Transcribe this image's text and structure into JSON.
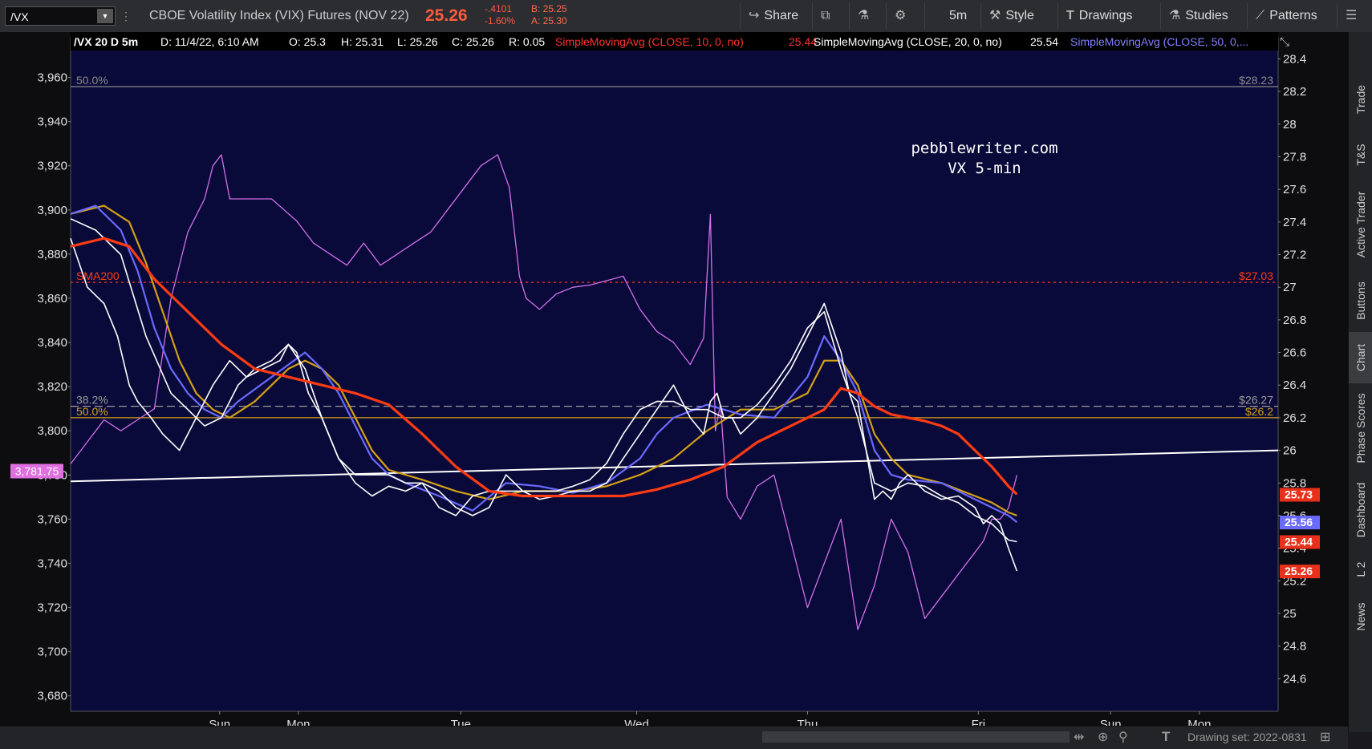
{
  "toolbar": {
    "symbol": "/VX",
    "description": "CBOE Volatility Index (VIX) Futures (NOV 22)",
    "last_price": "25.26",
    "net_change": "-.4101",
    "pct_change": "-1.60%",
    "bid": "B: 25.25",
    "ask": "A: 25.30",
    "share_label": "Share",
    "timeframe": "5m",
    "style_label": "Style",
    "drawings_label": "Drawings",
    "studies_label": "Studies",
    "patterns_label": "Patterns"
  },
  "header": {
    "title": "/VX 20 D 5m",
    "date": "D: 11/4/22, 6:10 AM",
    "open": "O: 25.3",
    "high": "H: 25.31",
    "low": "L: 25.26",
    "close": "C: 25.26",
    "range": "R: 0.05",
    "sma1_label": "SimpleMovingAvg (CLOSE, 10, 0, no)",
    "sma1_value": "25.44",
    "sma2_label": "SimpleMovingAvg (CLOSE, 20, 0, no)",
    "sma2_value": "25.54",
    "sma3_label": "SimpleMovingAvg (CLOSE, 50, 0,..."
  },
  "watermark": {
    "line1": "pebblewriter.com",
    "line2": "VX 5-min"
  },
  "side_tabs": [
    "Trade",
    "T&S",
    "Active Trader",
    "Buttons",
    "Chart",
    "Phase Scores",
    "Dashboard",
    "L 2",
    "News"
  ],
  "status_bar": {
    "drawing_set": "Drawing set: 2022-0831"
  },
  "colors": {
    "background": "#0a0a3a",
    "spx": "#d070e8",
    "price": "#ffffff",
    "sma200": "#ff3b14",
    "sma10": "#ff3030",
    "sma20": "#ffffff",
    "sma50": "#7070ff",
    "sma_gold": "#d4a017",
    "fib_gold": "#d4a017"
  },
  "chart_data": {
    "type": "line",
    "left_axis": {
      "ylim": [
        3673,
        3978
      ],
      "ticks": [
        3680,
        3700,
        3720,
        3740,
        3760,
        3780,
        3800,
        3820,
        3840,
        3860,
        3880,
        3900,
        3920,
        3940,
        3960
      ],
      "marker": "3,781.75"
    },
    "right_axis": {
      "ylim": [
        24.4,
        28.53
      ],
      "ticks": [
        24.6,
        24.8,
        25,
        25.2,
        25.4,
        25.6,
        25.8,
        26,
        26.2,
        26.4,
        26.6,
        26.8,
        27,
        27.2,
        27.4,
        27.6,
        27.8,
        28,
        28.2,
        28.4
      ]
    },
    "x_axis": {
      "xlim": [
        0,
        7.21
      ],
      "tick_labels": [
        "Sun",
        "Mon",
        "Tue",
        "Wed",
        "Thu",
        "Fri",
        "Sun",
        "Mon"
      ],
      "tick_positions": [
        0.89,
        1.36,
        2.33,
        3.38,
        4.4,
        5.42,
        6.21,
        6.74
      ]
    },
    "levels": [
      {
        "label": "50.0%",
        "value_label": "$28.23",
        "value": 28.23,
        "style": "solid-gray"
      },
      {
        "label": "SMA200",
        "value_label": "$27.03",
        "value": 27.03,
        "style": "dashed-red"
      },
      {
        "label": "38.2%",
        "value_label": "$26.27",
        "value": 26.27,
        "style": "dashed-gray"
      },
      {
        "label": "50.0%",
        "value_label": "$26.2",
        "value": 26.2,
        "style": "solid-gold"
      }
    ],
    "trendline": {
      "x": [
        0,
        7.21
      ],
      "y": [
        25.81,
        26.0
      ]
    },
    "price_labels": [
      {
        "text": "25.73",
        "value": 25.73,
        "color": "#e8301a"
      },
      {
        "text": "25.56",
        "value": 25.56,
        "color": "#6a6aff"
      },
      {
        "text": "25.44",
        "value": 25.44,
        "color": "#e8301a"
      },
      {
        "text": "25.26",
        "value": 25.26,
        "color": "#e8301a"
      }
    ],
    "series": [
      {
        "name": "VX",
        "color": "#ffffff",
        "axis": "right",
        "x": [
          0,
          0.1,
          0.2,
          0.28,
          0.35,
          0.4,
          0.48,
          0.55,
          0.65,
          0.75,
          0.85,
          0.95,
          1.05,
          1.15,
          1.25,
          1.3,
          1.35,
          1.42,
          1.5,
          1.6,
          1.7,
          1.8,
          1.9,
          2.0,
          2.1,
          2.2,
          2.3,
          2.4,
          2.5,
          2.6,
          2.7,
          2.8,
          2.9,
          3.0,
          3.1,
          3.2,
          3.3,
          3.4,
          3.5,
          3.6,
          3.7,
          3.78,
          3.82,
          3.86,
          3.9,
          3.95,
          4.0,
          4.1,
          4.2,
          4.3,
          4.4,
          4.5,
          4.6,
          4.65,
          4.7,
          4.75,
          4.8,
          4.85,
          4.9,
          4.95,
          5.0,
          5.1,
          5.2,
          5.3,
          5.4,
          5.45,
          5.5,
          5.55,
          5.6,
          5.65
        ],
        "values": [
          27.3,
          27.0,
          26.9,
          26.7,
          26.4,
          26.3,
          26.2,
          26.1,
          26.0,
          26.2,
          26.4,
          26.55,
          26.45,
          26.5,
          26.55,
          26.65,
          26.6,
          26.35,
          26.2,
          25.95,
          25.8,
          25.72,
          25.78,
          25.75,
          25.8,
          25.75,
          25.65,
          25.6,
          25.65,
          25.85,
          25.75,
          25.7,
          25.72,
          25.75,
          25.75,
          25.8,
          25.95,
          26.1,
          26.25,
          26.4,
          26.2,
          26.1,
          26.3,
          26.35,
          26.2,
          26.2,
          26.1,
          26.2,
          26.35,
          26.5,
          26.7,
          26.9,
          26.6,
          26.35,
          26.3,
          26.0,
          25.7,
          25.75,
          25.7,
          25.8,
          25.85,
          25.75,
          25.7,
          25.72,
          25.65,
          25.55,
          25.6,
          25.55,
          25.4,
          25.26
        ]
      },
      {
        "name": "SMA 20",
        "color": "#ffffff",
        "axis": "right",
        "x": [
          0,
          0.15,
          0.3,
          0.45,
          0.6,
          0.7,
          0.8,
          0.9,
          1.0,
          1.1,
          1.2,
          1.3,
          1.4,
          1.5,
          1.6,
          1.7,
          1.8,
          1.9,
          2.0,
          2.1,
          2.2,
          2.3,
          2.4,
          2.5,
          2.6,
          2.7,
          2.8,
          2.9,
          3.0,
          3.1,
          3.2,
          3.3,
          3.4,
          3.5,
          3.6,
          3.7,
          3.8,
          3.9,
          4.0,
          4.1,
          4.2,
          4.3,
          4.4,
          4.5,
          4.6,
          4.7,
          4.8,
          4.9,
          5.0,
          5.1,
          5.2,
          5.3,
          5.4,
          5.5,
          5.6,
          5.65
        ],
        "values": [
          27.42,
          27.35,
          27.2,
          26.7,
          26.35,
          26.25,
          26.15,
          26.2,
          26.4,
          26.5,
          26.55,
          26.65,
          26.5,
          26.2,
          25.95,
          25.85,
          25.85,
          25.85,
          25.8,
          25.8,
          25.65,
          25.6,
          25.72,
          25.75,
          25.75,
          25.75,
          25.75,
          25.75,
          25.78,
          25.82,
          25.92,
          26.1,
          26.25,
          26.3,
          26.3,
          26.25,
          26.25,
          26.2,
          26.2,
          26.28,
          26.4,
          26.55,
          26.75,
          26.85,
          26.5,
          26.2,
          25.8,
          25.75,
          25.8,
          25.78,
          25.72,
          25.68,
          25.6,
          25.55,
          25.45,
          25.44
        ]
      },
      {
        "name": "SMA 50",
        "color": "#6a6aff",
        "axis": "right",
        "x": [
          0,
          0.15,
          0.3,
          0.4,
          0.5,
          0.6,
          0.7,
          0.8,
          0.9,
          1.0,
          1.2,
          1.4,
          1.5,
          1.6,
          1.7,
          1.8,
          1.9,
          2.0,
          2.2,
          2.4,
          2.6,
          2.8,
          3.0,
          3.2,
          3.4,
          3.5,
          3.6,
          3.8,
          4.0,
          4.2,
          4.4,
          4.5,
          4.6,
          4.7,
          4.8,
          4.9,
          5.0,
          5.2,
          5.4,
          5.6,
          5.65
        ],
        "values": [
          27.45,
          27.5,
          27.35,
          27.1,
          26.75,
          26.5,
          26.35,
          26.25,
          26.2,
          26.3,
          26.45,
          26.6,
          26.5,
          26.35,
          26.15,
          25.95,
          25.85,
          25.8,
          25.72,
          25.63,
          25.8,
          25.78,
          25.74,
          25.8,
          25.95,
          26.1,
          26.2,
          26.28,
          26.22,
          26.2,
          26.45,
          26.7,
          26.55,
          26.35,
          26.0,
          25.85,
          25.82,
          25.8,
          25.7,
          25.6,
          25.56
        ]
      },
      {
        "name": "SMA gold",
        "color": "#d4a017",
        "axis": "right",
        "x": [
          0,
          0.2,
          0.35,
          0.45,
          0.55,
          0.65,
          0.75,
          0.85,
          0.95,
          1.1,
          1.3,
          1.4,
          1.5,
          1.6,
          1.7,
          1.8,
          1.9,
          2.1,
          2.3,
          2.5,
          2.7,
          3.0,
          3.2,
          3.4,
          3.6,
          3.8,
          4.0,
          4.2,
          4.4,
          4.5,
          4.6,
          4.7,
          4.8,
          4.9,
          5.0,
          5.2,
          5.4,
          5.5,
          5.6,
          5.65
        ],
        "values": [
          27.45,
          27.5,
          27.4,
          27.15,
          26.85,
          26.55,
          26.35,
          26.25,
          26.2,
          26.3,
          26.5,
          26.55,
          26.5,
          26.4,
          26.2,
          26.0,
          25.88,
          25.82,
          25.75,
          25.7,
          25.75,
          25.75,
          25.78,
          25.85,
          25.95,
          26.12,
          26.25,
          26.25,
          26.35,
          26.55,
          26.55,
          26.4,
          26.1,
          25.95,
          25.85,
          25.8,
          25.72,
          25.68,
          25.62,
          25.6
        ]
      },
      {
        "name": "SMA200",
        "color": "#ff3b14",
        "axis": "right",
        "x": [
          0,
          0.2,
          0.35,
          0.5,
          0.7,
          0.9,
          1.1,
          1.3,
          1.5,
          1.7,
          1.9,
          2.1,
          2.3,
          2.5,
          2.7,
          2.9,
          3.1,
          3.3,
          3.5,
          3.7,
          3.9,
          4.1,
          4.3,
          4.5,
          4.6,
          4.7,
          4.8,
          4.9,
          5.0,
          5.1,
          5.2,
          5.3,
          5.4,
          5.5,
          5.6,
          5.65
        ],
        "values": [
          27.25,
          27.3,
          27.25,
          27.05,
          26.85,
          26.65,
          26.5,
          26.45,
          26.4,
          26.35,
          26.28,
          26.1,
          25.9,
          25.75,
          25.72,
          25.72,
          25.72,
          25.72,
          25.76,
          25.82,
          25.9,
          26.05,
          26.15,
          26.25,
          26.38,
          26.35,
          26.27,
          26.22,
          26.2,
          26.18,
          26.15,
          26.1,
          26.0,
          25.9,
          25.78,
          25.73
        ]
      },
      {
        "name": "SPX",
        "color": "#d070e8",
        "axis": "left",
        "x": [
          0,
          0.1,
          0.2,
          0.3,
          0.4,
          0.5,
          0.6,
          0.7,
          0.8,
          0.85,
          0.9,
          0.95,
          1.05,
          1.2,
          1.35,
          1.45,
          1.55,
          1.65,
          1.75,
          1.85,
          1.95,
          2.05,
          2.15,
          2.25,
          2.35,
          2.45,
          2.55,
          2.62,
          2.68,
          2.72,
          2.8,
          2.9,
          3.0,
          3.1,
          3.2,
          3.3,
          3.4,
          3.5,
          3.6,
          3.7,
          3.78,
          3.82,
          3.85,
          3.88,
          3.92,
          4.0,
          4.1,
          4.2,
          4.3,
          4.4,
          4.5,
          4.6,
          4.7,
          4.8,
          4.9,
          5.0,
          5.1,
          5.2,
          5.3,
          5.4,
          5.45,
          5.5,
          5.55,
          5.6,
          5.65
        ],
        "values": [
          3785,
          3795,
          3805,
          3800,
          3805,
          3810,
          3860,
          3890,
          3905,
          3920,
          3925,
          3905,
          3905,
          3905,
          3895,
          3885,
          3880,
          3875,
          3885,
          3875,
          3880,
          3885,
          3890,
          3900,
          3910,
          3920,
          3925,
          3910,
          3870,
          3860,
          3855,
          3862,
          3865,
          3866,
          3868,
          3870,
          3855,
          3845,
          3840,
          3830,
          3842,
          3898,
          3800,
          3812,
          3770,
          3760,
          3775,
          3780,
          3750,
          3720,
          3740,
          3760,
          3710,
          3730,
          3760,
          3745,
          3715,
          3725,
          3735,
          3745,
          3750,
          3760,
          3760,
          3765,
          3780
        ]
      }
    ]
  }
}
